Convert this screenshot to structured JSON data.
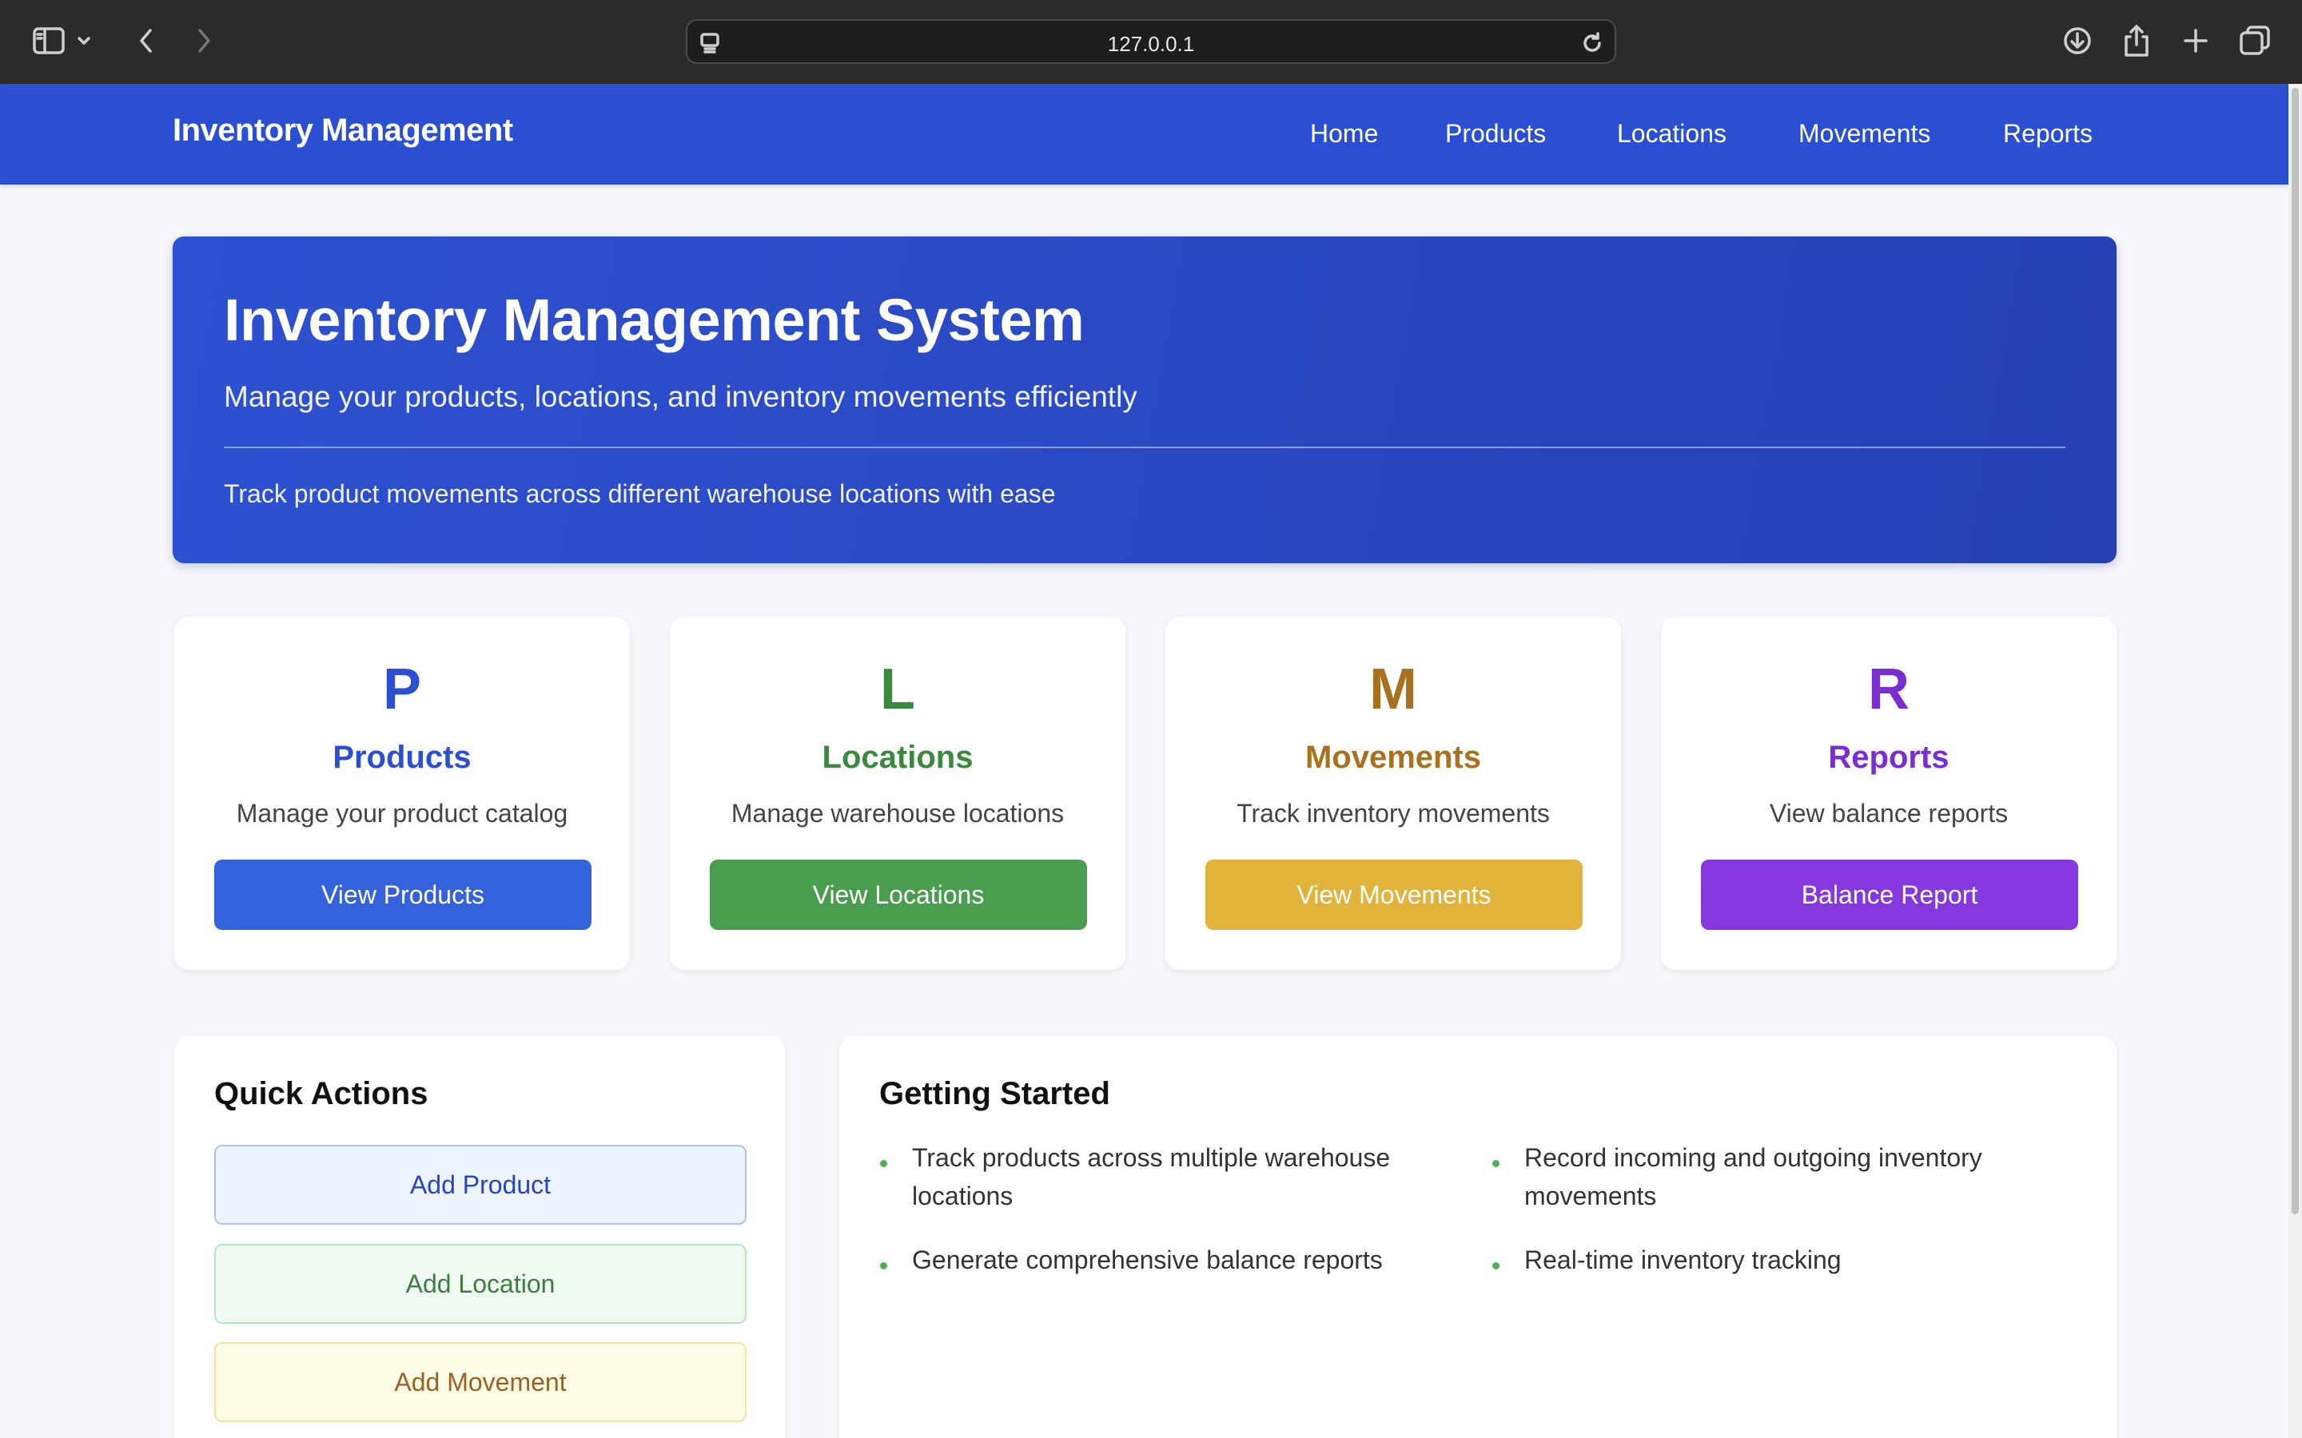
{
  "browser": {
    "url": "127.0.0.1"
  },
  "nav": {
    "brand": "Inventory Management",
    "links": [
      "Home",
      "Products",
      "Locations",
      "Movements",
      "Reports"
    ]
  },
  "hero": {
    "title": "Inventory Management System",
    "subtitle": "Manage your products, locations, and inventory movements efficiently",
    "note": "Track product movements across different warehouse locations with ease"
  },
  "cards": [
    {
      "letter": "P",
      "title": "Products",
      "desc": "Manage your product catalog",
      "button": "View Products",
      "color": "#2c4fcf",
      "button_color": "#3461dc"
    },
    {
      "letter": "L",
      "title": "Locations",
      "desc": "Manage warehouse locations",
      "button": "View Locations",
      "color": "#3a8a3e",
      "button_color": "#4a9d4f"
    },
    {
      "letter": "M",
      "title": "Movements",
      "desc": "Track inventory movements",
      "button": "View Movements",
      "color": "#a8711f",
      "button_color": "#e2b33a"
    },
    {
      "letter": "R",
      "title": "Reports",
      "desc": "View balance reports",
      "button": "Balance Report",
      "color": "#7a2dd0",
      "button_color": "#8638e0"
    }
  ],
  "quick_actions": {
    "title": "Quick Actions",
    "buttons": [
      {
        "label": "Add Product",
        "text_color": "#2545c4",
        "bg": "#eef4fe",
        "border": "#a9c3f3"
      },
      {
        "label": "Add Location",
        "text_color": "#3d7d3f",
        "bg": "#effbf2",
        "border": "#b6e6c1"
      },
      {
        "label": "Add Movement",
        "text_color": "#9a6220",
        "bg": "#fefbe6",
        "border": "#f2e29a"
      }
    ]
  },
  "getting_started": {
    "title": "Getting Started",
    "items": [
      "Track products across multiple warehouse locations",
      "Record incoming and outgoing inventory movements",
      "Generate comprehensive balance reports",
      "Real-time inventory tracking"
    ]
  }
}
